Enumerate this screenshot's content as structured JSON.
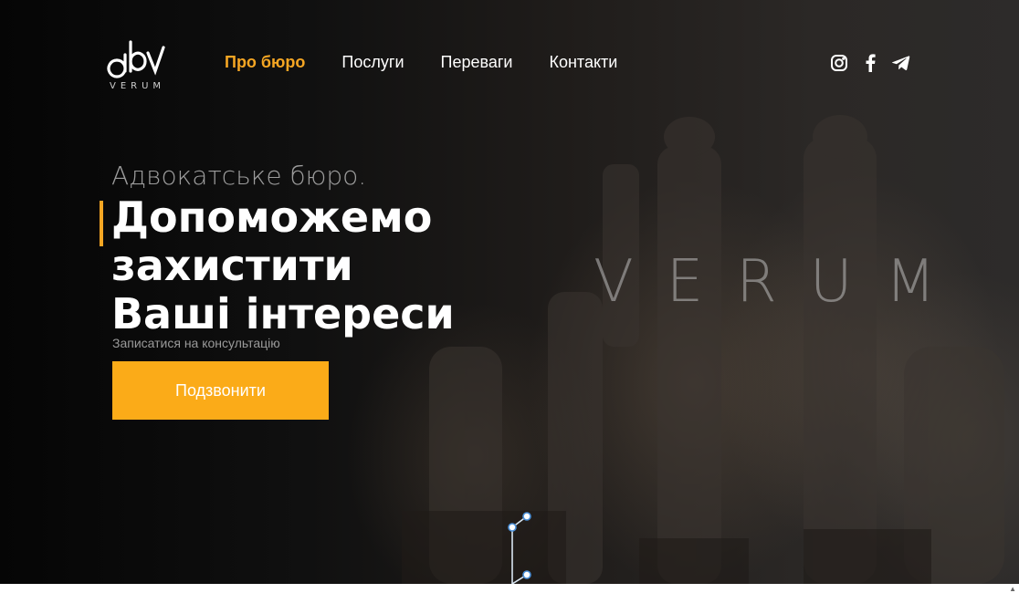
{
  "header": {
    "logo": {
      "mark": "abv",
      "text": "VERUM"
    },
    "nav": [
      {
        "label": "Про бюро",
        "active": true
      },
      {
        "label": "Послуги",
        "active": false
      },
      {
        "label": "Переваги",
        "active": false
      },
      {
        "label": "Контакти",
        "active": false
      }
    ],
    "social": [
      {
        "icon": "instagram-icon"
      },
      {
        "icon": "facebook-icon"
      },
      {
        "icon": "telegram-icon"
      }
    ]
  },
  "hero": {
    "eyebrow": "Адвокатське бюро.",
    "headline_line1": "Допоможемо захистити",
    "headline_line2": "Ваші інтереси",
    "watermark": "VERUM",
    "cta_label": "Записатися на консультацію",
    "cta_button": "Подзвонити"
  },
  "colors": {
    "accent": "#f5a623",
    "button": "#fbab18",
    "background": "#0a0a0a"
  }
}
